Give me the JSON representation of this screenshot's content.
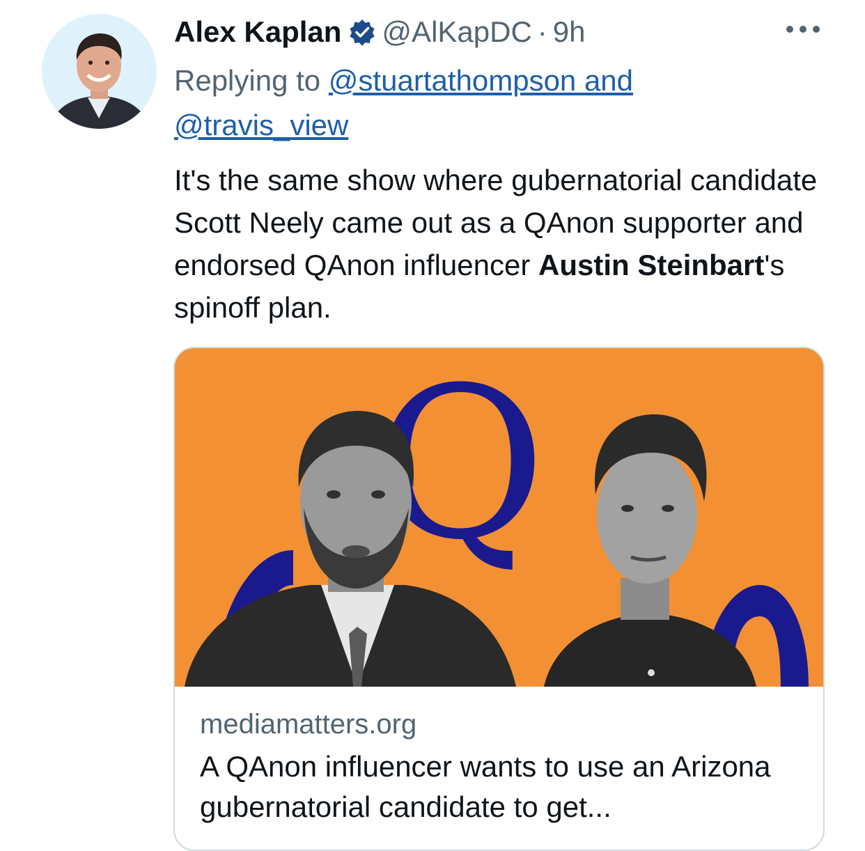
{
  "tweet": {
    "author_name": "Alex Kaplan",
    "handle": "@AlKapDC",
    "separator": "·",
    "time": "9h",
    "reply_prefix": "Replying to",
    "reply_mentions": [
      "@stuartathompson and",
      "@travis_view"
    ],
    "text_before": "It's the same show where gubernatorial candidate Scott Neely came out as a QAnon supporter and endorsed QAnon influencer ",
    "text_bold": "Austin Steinbart",
    "text_after": "'s spinoff plan."
  },
  "card": {
    "image_letter": "Q",
    "domain": "mediamatters.org",
    "title": "A QAnon influencer wants to use an Arizona gubernatorial candidate to get..."
  },
  "icons": {
    "verified": "verified-badge-icon",
    "more": "more-options-icon"
  },
  "colors": {
    "text": "#0f1419",
    "secondary": "#536471",
    "link": "#1d5fa8",
    "verified": "#1d4b8a",
    "card_orange": "#f39034",
    "q_blue": "#1a1a8e",
    "border": "#cfd9de"
  }
}
